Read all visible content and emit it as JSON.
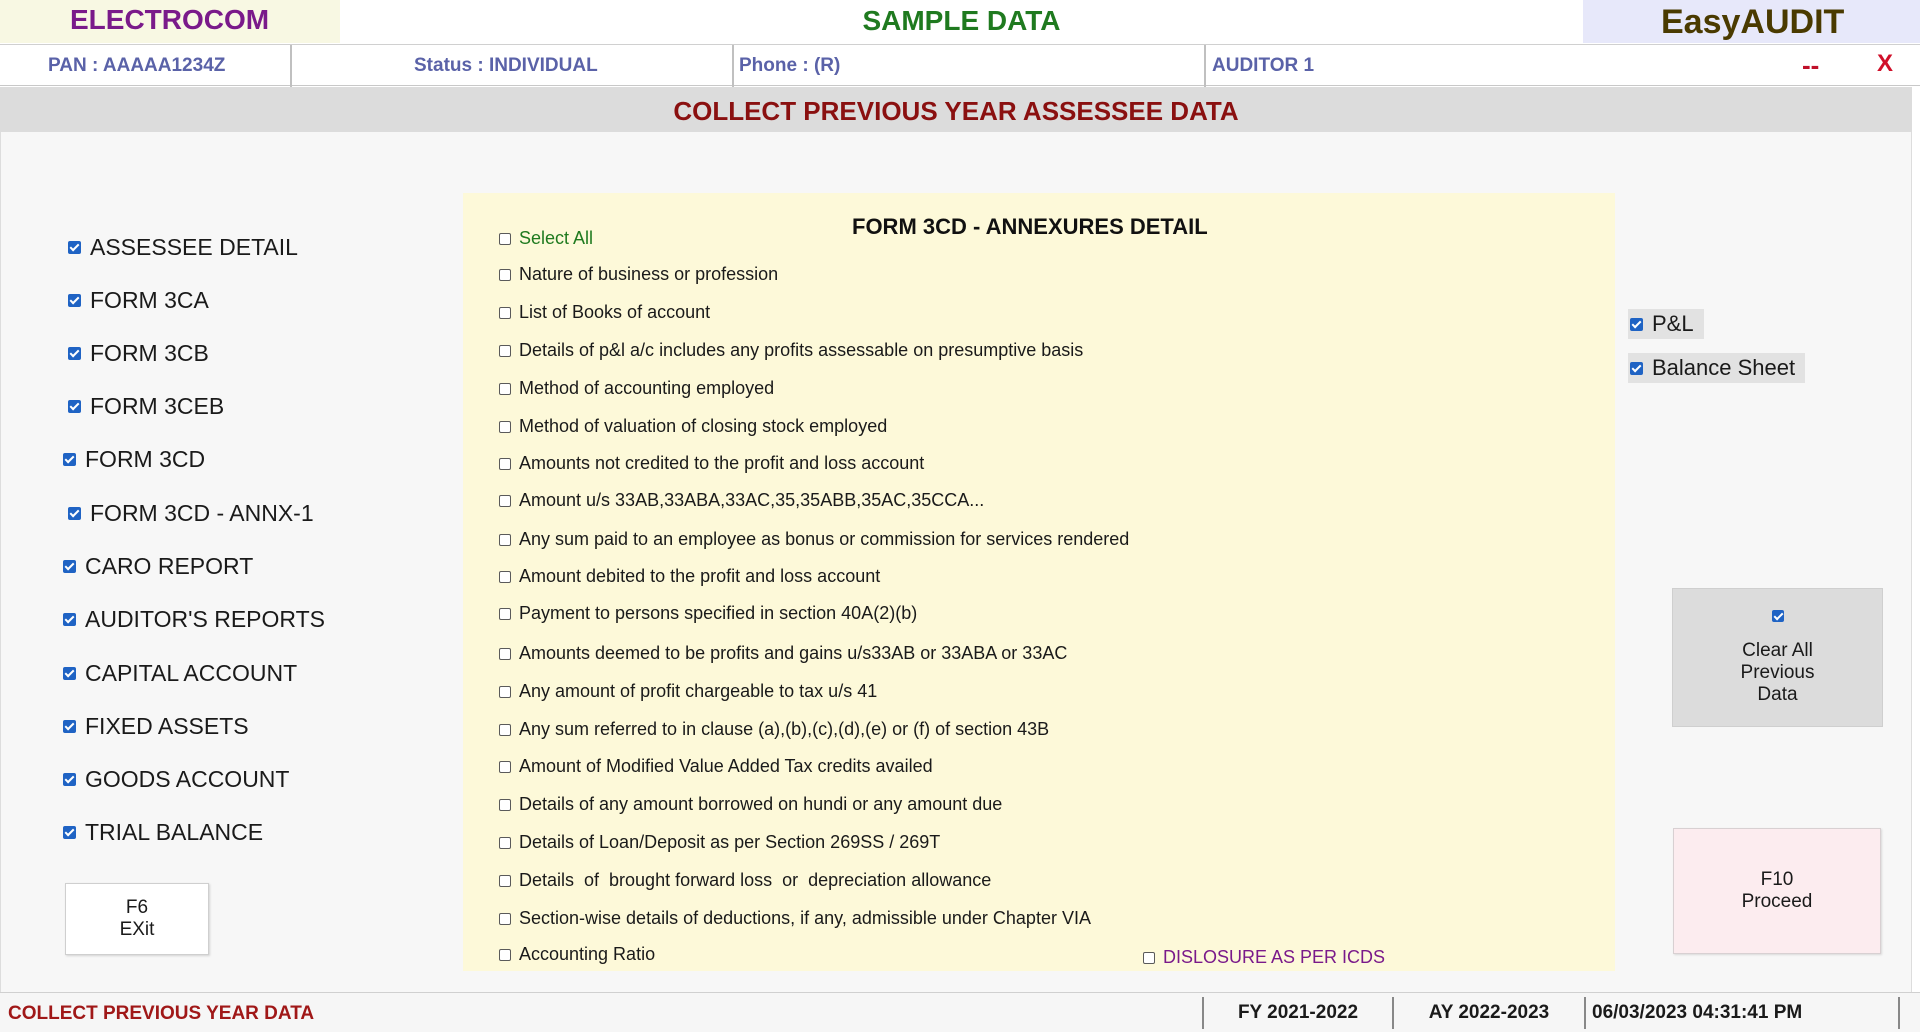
{
  "titlebar": {
    "company": "ELECTROCOM",
    "center": "SAMPLE DATA",
    "app": "EasyAUDIT"
  },
  "info": {
    "pan": "PAN  :  AAAAA1234Z",
    "status": "Status  :  INDIVIDUAL",
    "phone": "Phone  : (R)",
    "auditor": "AUDITOR 1",
    "minimize": "--",
    "close": "X"
  },
  "header": {
    "title": "COLLECT PREVIOUS YEAR ASSESSEE DATA"
  },
  "left_options": [
    {
      "label": "ASSESSEE DETAIL",
      "checked": true
    },
    {
      "label": "FORM 3CA",
      "checked": true
    },
    {
      "label": "FORM 3CB",
      "checked": true
    },
    {
      "label": "FORM 3CEB",
      "checked": true
    },
    {
      "label": "FORM 3CD",
      "checked": true
    },
    {
      "label": "FORM 3CD - ANNX-1",
      "checked": true
    },
    {
      "label": "CARO REPORT",
      "checked": true
    },
    {
      "label": "AUDITOR'S REPORTS",
      "checked": true
    },
    {
      "label": "CAPITAL ACCOUNT",
      "checked": true
    },
    {
      "label": "FIXED ASSETS",
      "checked": true
    },
    {
      "label": "GOODS ACCOUNT",
      "checked": true
    },
    {
      "label": "TRIAL BALANCE",
      "checked": true
    }
  ],
  "panel": {
    "title": "FORM 3CD - ANNEXURES DETAIL",
    "select_all": "Select All",
    "items": [
      "Nature of business or profession",
      "List of Books of account",
      "Details of p&l a/c includes any profits assessable on presumptive basis",
      "Method of accounting employed",
      "Method of valuation of closing stock employed",
      "Amounts not credited to the profit and loss account",
      "Amount u/s 33AB,33ABA,33AC,35,35ABB,35AC,35CCA...",
      "Any sum paid to an employee as bonus or commission for services rendered",
      "Amount debited to the profit and loss account",
      "Payment to persons specified in section 40A(2)(b)",
      "Amounts deemed to be profits and gains u/s33AB or 33ABA or 33AC",
      "Any amount of profit chargeable to tax u/s 41",
      "Any sum referred to in clause (a),(b),(c),(d),(e) or (f) of section 43B",
      "Amount of Modified Value Added Tax credits availed",
      "Details of any amount borrowed on hundi or any amount due",
      "Details of Loan/Deposit as per Section 269SS / 269T",
      "Details  of  brought forward loss  or  depreciation allowance",
      "Section-wise details of deductions, if any, admissible under Chapter VIA",
      "Accounting Ratio"
    ],
    "disclosure": "DISLOSURE AS PER ICDS"
  },
  "right_options": {
    "pl": "P&L",
    "balance_sheet": "Balance Sheet"
  },
  "buttons": {
    "exit_key": "F6",
    "exit_label": "EXit",
    "clear_l1": "Clear All",
    "clear_l2": "Previous",
    "clear_l3": "Data",
    "proceed_key": "F10",
    "proceed_label": "Proceed"
  },
  "statusbar": {
    "left": "COLLECT PREVIOUS YEAR DATA",
    "fy": "FY 2021-2022",
    "ay": "AY 2022-2023",
    "datetime": "06/03/2023 04:31:41 PM"
  },
  "colors": {
    "accent_checkbox": "#1f63c4",
    "header_text": "#8a1010",
    "panel_bg": "#fdf9d9"
  }
}
